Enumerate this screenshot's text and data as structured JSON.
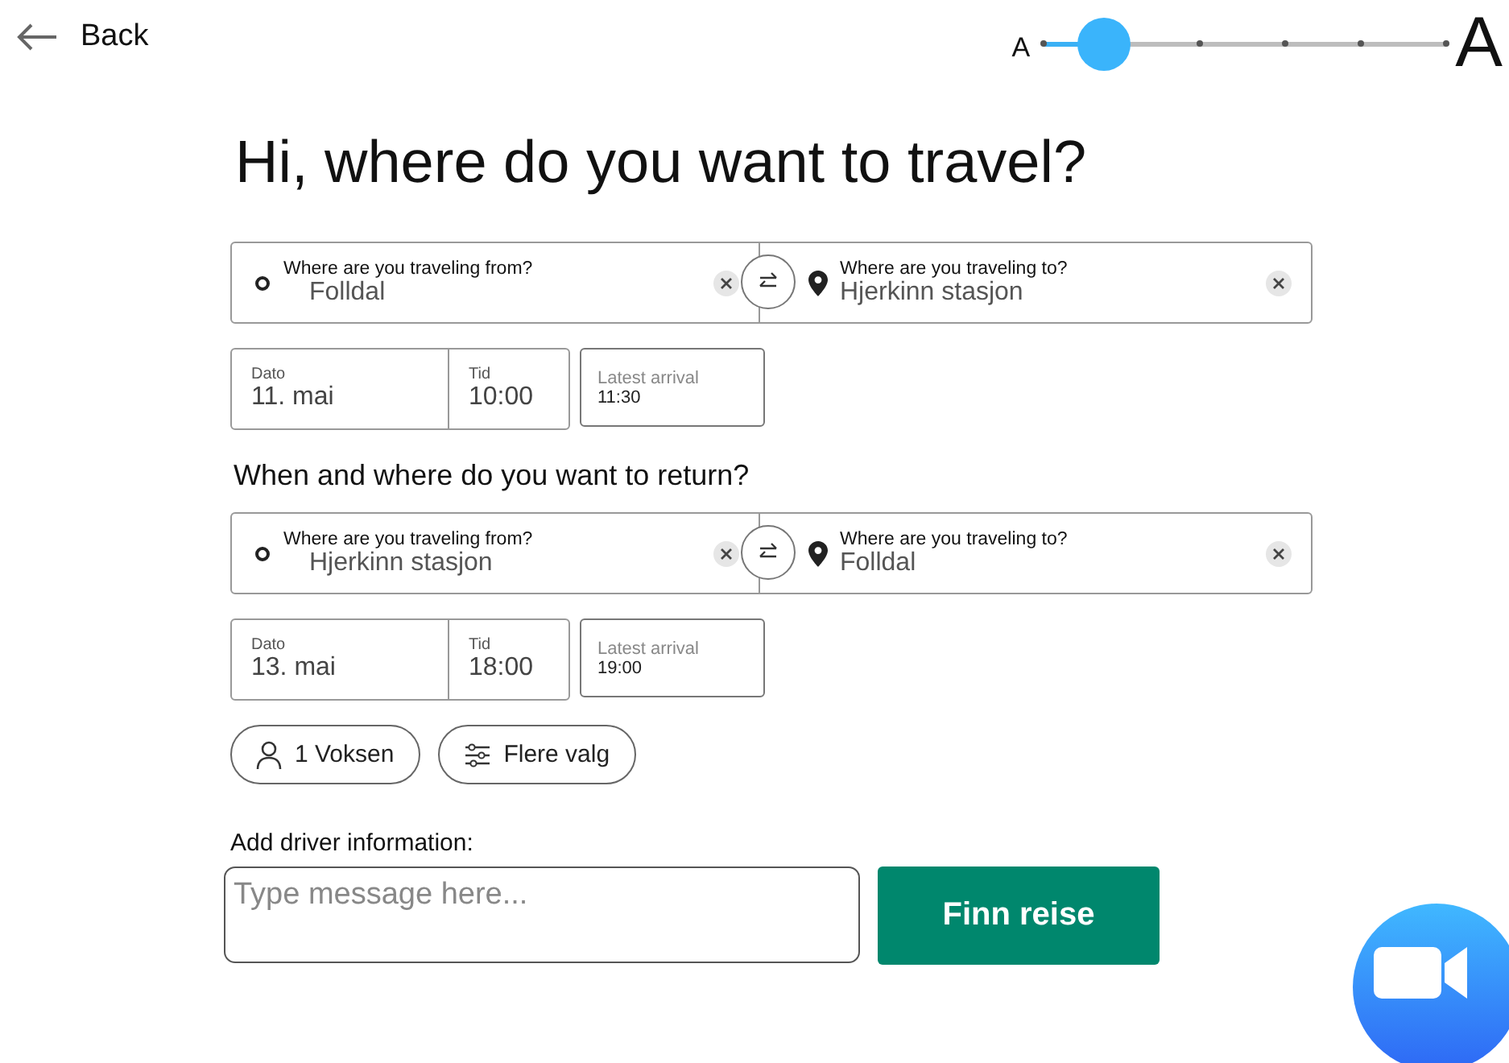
{
  "back": {
    "label": "Back"
  },
  "text_size": {
    "small_label": "A",
    "large_label": "A",
    "level": 0.15
  },
  "heading": "Hi, where do you want to travel?",
  "trips": [
    {
      "from": {
        "label": "Where are you traveling from?",
        "value": "Folldal"
      },
      "to": {
        "label": "Where are you traveling to?",
        "value": "Hjerkinn stasjon"
      },
      "date": {
        "label": "Dato",
        "value": "11. mai"
      },
      "time": {
        "label": "Tid",
        "value": "10:00"
      },
      "arrival": {
        "label": "Latest arrival",
        "value": "11:30"
      }
    },
    {
      "title": "When and where do you want to return?",
      "from": {
        "label": "Where are you traveling from?",
        "value": "Hjerkinn stasjon"
      },
      "to": {
        "label": "Where are you traveling to?",
        "value": "Folldal"
      },
      "date": {
        "label": "Dato",
        "value": "13. mai"
      },
      "time": {
        "label": "Tid",
        "value": "18:00"
      },
      "arrival": {
        "label": "Latest arrival",
        "value": "19:00"
      }
    }
  ],
  "options": [
    {
      "kind": "passengers",
      "label": "1 Voksen"
    },
    {
      "kind": "filters",
      "label": "Flere valg"
    }
  ],
  "driver_info": {
    "label": "Add driver information:",
    "placeholder": "Type message here..."
  },
  "submit": "Finn reise"
}
